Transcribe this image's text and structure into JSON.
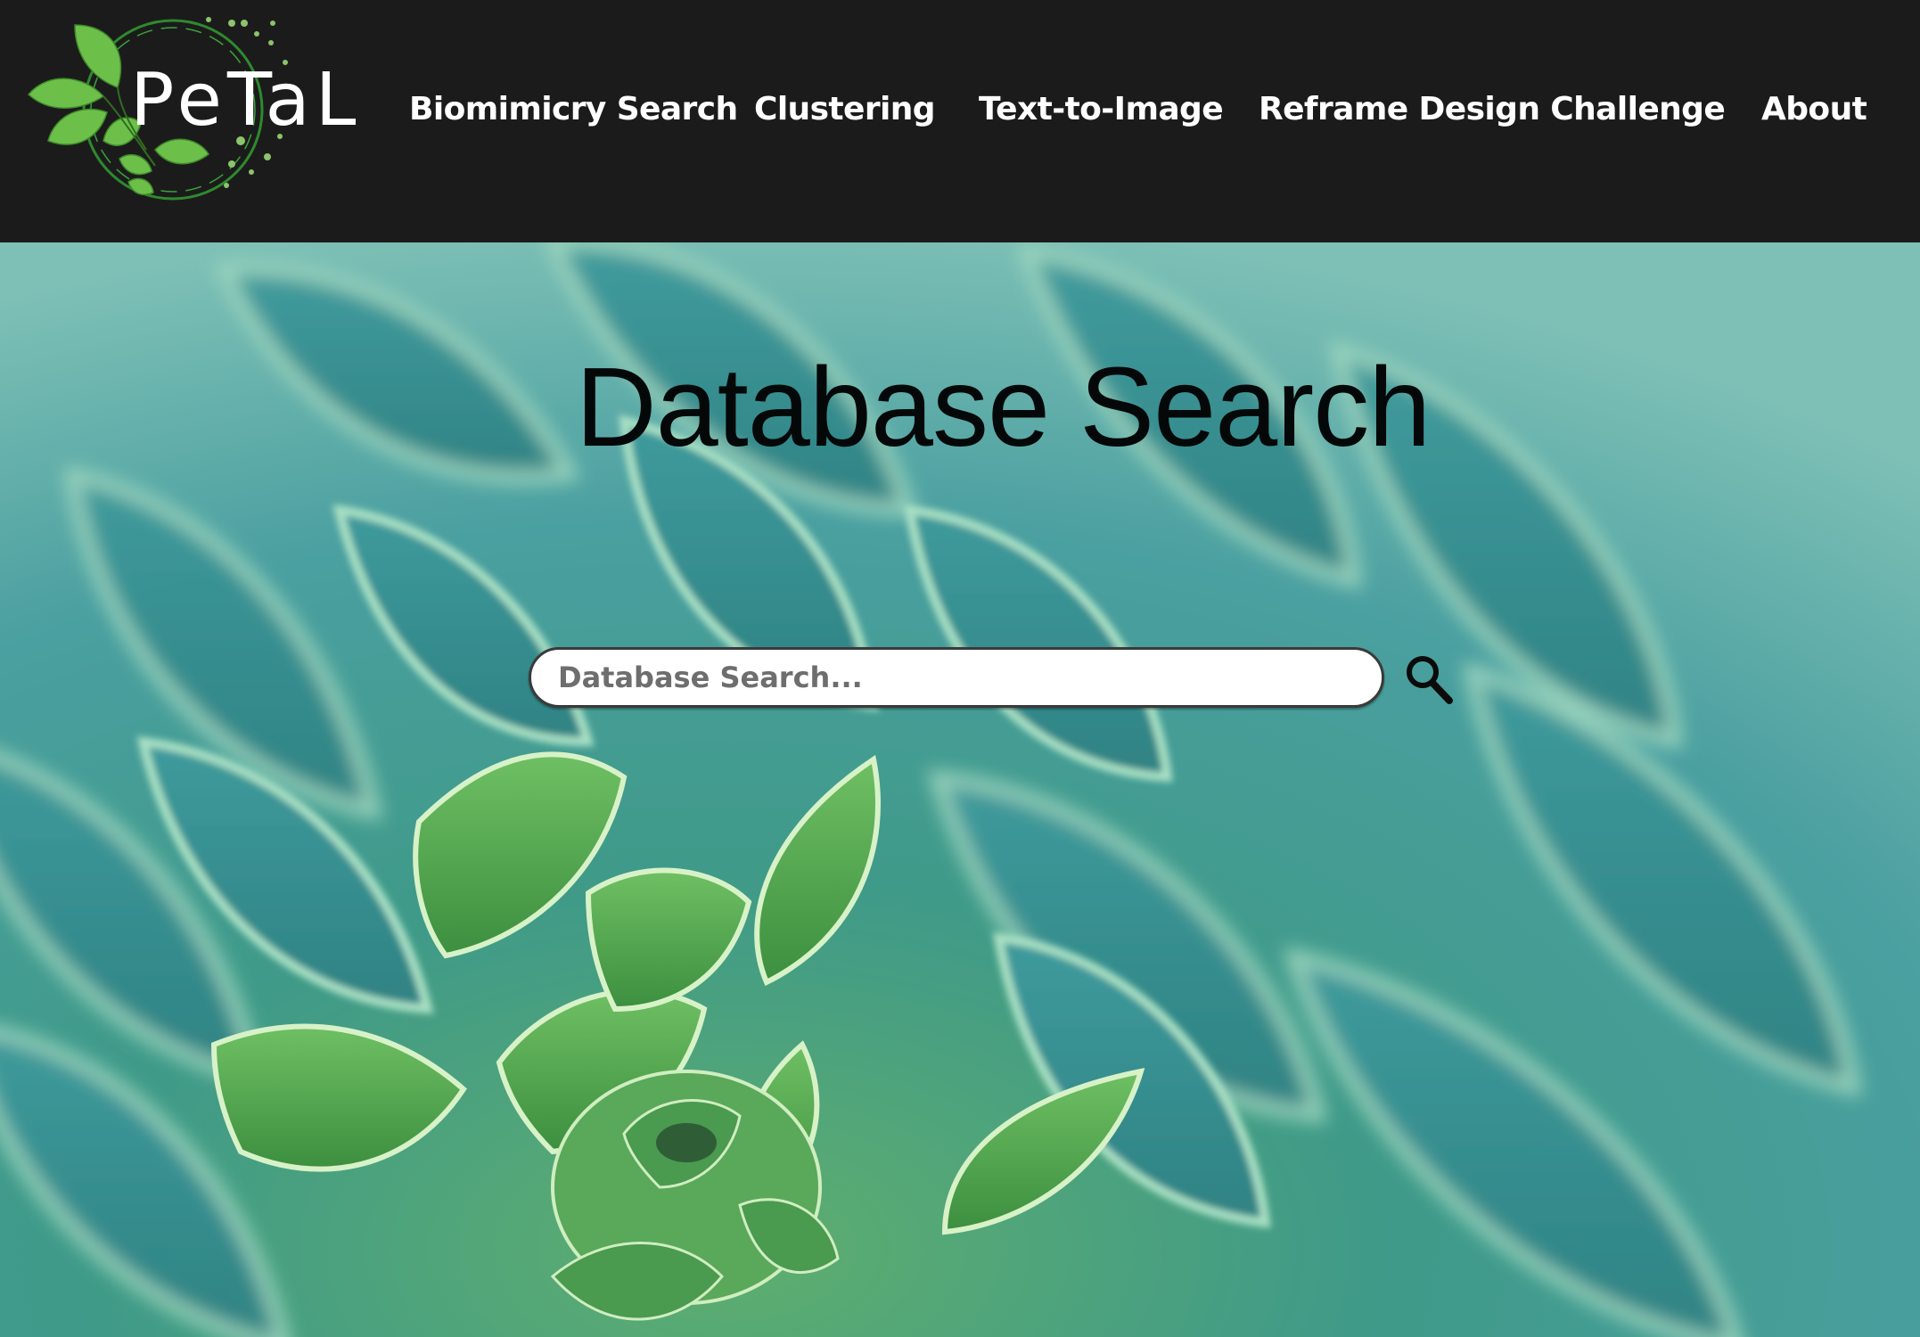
{
  "header": {
    "logo_icon": "petal-leaf-logo",
    "logo_text": "PeTaL",
    "nav": [
      {
        "label": "Biomimicry Search"
      },
      {
        "label": "Clustering"
      },
      {
        "label": "Text-to-Image"
      },
      {
        "label": "Reframe Design Challenge"
      },
      {
        "label": "About"
      }
    ]
  },
  "hero": {
    "title": "Database Search",
    "search": {
      "placeholder": "Database Search...",
      "value": "",
      "button_icon": "search-icon"
    }
  },
  "colors": {
    "header_bg": "#1c1b1c",
    "nav_text": "#ffffff",
    "leaf_green": "#6cc04a",
    "hero_teal": "#4f9d93"
  }
}
